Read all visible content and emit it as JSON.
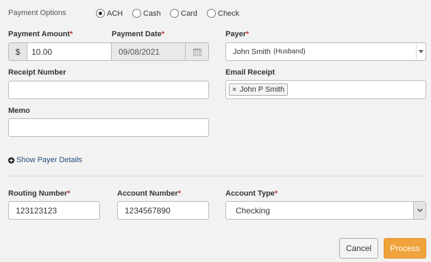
{
  "payment_options": {
    "label": "Payment Options",
    "options": [
      "ACH",
      "Cash",
      "Card",
      "Check"
    ],
    "selected": "ACH"
  },
  "payment_amount": {
    "label": "Payment Amount",
    "prefix": "$",
    "value": "10.00"
  },
  "payment_date": {
    "label": "Payment Date",
    "value": "09/08/2021"
  },
  "payer": {
    "label": "Payer",
    "name": "John Smith",
    "relation": "(Husband)"
  },
  "receipt_number": {
    "label": "Receipt Number",
    "value": ""
  },
  "email_receipt": {
    "label": "Email Receipt",
    "tag": "John P Smith"
  },
  "memo": {
    "label": "Memo",
    "value": ""
  },
  "show_payer_details": "Show Payer Details",
  "routing_number": {
    "label": "Routing Number",
    "value": "123123123"
  },
  "account_number": {
    "label": "Account Number",
    "value": "1234567890"
  },
  "account_type": {
    "label": "Account Type",
    "value": "Checking"
  },
  "buttons": {
    "cancel": "Cancel",
    "process": "Process"
  },
  "required_mark": "*",
  "colors": {
    "accent": "#f0a23b",
    "link": "#1f4e79",
    "required": "#c9302c"
  }
}
